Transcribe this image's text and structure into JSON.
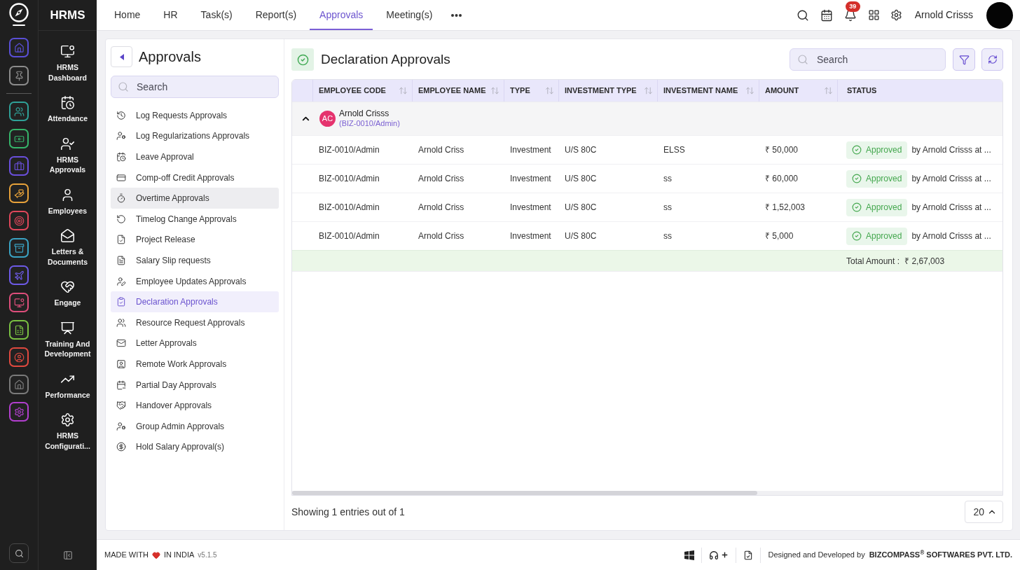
{
  "rail": {
    "pinned": [
      {
        "color": "#5a4fd6"
      },
      {
        "color": "#8c8c8c"
      }
    ],
    "apps": [
      {
        "color": "#2fa198"
      },
      {
        "color": "#35b56a"
      },
      {
        "color": "#6a4fdc"
      },
      {
        "color": "#e8a23a"
      },
      {
        "color": "#e0475b"
      },
      {
        "color": "#3aa3c4"
      },
      {
        "color": "#6d5ae6"
      },
      {
        "color": "#de4e7b"
      },
      {
        "color": "#7ac142"
      },
      {
        "color": "#e0493f"
      },
      {
        "color": "#7a7a7a"
      },
      {
        "color": "#b23fcf"
      }
    ]
  },
  "sidebar": {
    "brand": "HRMS",
    "items": [
      {
        "label": "HRMS Dashboard"
      },
      {
        "label": "Attendance"
      },
      {
        "label": "HRMS Approvals"
      },
      {
        "label": "Employees"
      },
      {
        "label": "Letters & Documents"
      },
      {
        "label": "Engage"
      },
      {
        "label": "Training And Development"
      },
      {
        "label": "Performance"
      },
      {
        "label": "HRMS Configurati..."
      }
    ]
  },
  "top_nav": {
    "tabs": [
      {
        "label": "Home",
        "selected": false
      },
      {
        "label": "HR",
        "selected": false
      },
      {
        "label": "Task(s)",
        "selected": false
      },
      {
        "label": "Report(s)",
        "selected": false
      },
      {
        "label": "Approvals",
        "selected": true
      },
      {
        "label": "Meeting(s)",
        "selected": false
      }
    ],
    "notifications": "39",
    "user_name": "Arnold Crisss"
  },
  "approvals_panel": {
    "title": "Approvals",
    "search": {
      "placeholder": "Search"
    },
    "items": [
      {
        "label": "Log Requests Approvals",
        "selected": false,
        "hovered": false
      },
      {
        "label": "Log Regularizations Approvals",
        "selected": false,
        "hovered": false
      },
      {
        "label": "Leave Approval",
        "selected": false,
        "hovered": false
      },
      {
        "label": "Comp-off Credit Approvals",
        "selected": false,
        "hovered": false
      },
      {
        "label": "Overtime Approvals",
        "selected": false,
        "hovered": true
      },
      {
        "label": "Timelog Change Approvals",
        "selected": false,
        "hovered": false
      },
      {
        "label": "Project Release",
        "selected": false,
        "hovered": false
      },
      {
        "label": "Salary Slip requests",
        "selected": false,
        "hovered": false
      },
      {
        "label": "Employee Updates Approvals",
        "selected": false,
        "hovered": false
      },
      {
        "label": "Declaration Approvals",
        "selected": true,
        "hovered": false
      },
      {
        "label": "Resource Request Approvals",
        "selected": false,
        "hovered": false
      },
      {
        "label": "Letter Approvals",
        "selected": false,
        "hovered": false
      },
      {
        "label": "Remote Work Approvals",
        "selected": false,
        "hovered": false
      },
      {
        "label": "Partial Day Approvals",
        "selected": false,
        "hovered": false
      },
      {
        "label": "Handover Approvals",
        "selected": false,
        "hovered": false
      },
      {
        "label": "Group Admin Approvals",
        "selected": false,
        "hovered": false
      },
      {
        "label": "Hold Salary Approval(s)",
        "selected": false,
        "hovered": false
      }
    ]
  },
  "declarations": {
    "title": "Declaration Approvals",
    "search": {
      "placeholder": "Search"
    },
    "table": {
      "columns": [
        {
          "label": "EMPLOYEE CODE",
          "sortable": true
        },
        {
          "label": "EMPLOYEE NAME",
          "sortable": true
        },
        {
          "label": "TYPE",
          "sortable": true
        },
        {
          "label": "INVESTMENT TYPE",
          "sortable": true
        },
        {
          "label": "INVESTMENT NAME",
          "sortable": true
        },
        {
          "label": "AMOUNT",
          "sortable": true
        },
        {
          "label": "STATUS",
          "sortable": false
        }
      ],
      "groups": [
        {
          "expanded": true,
          "initials": "AC",
          "name": "Arnold Crisss",
          "code": "(BIZ-0010/Admin)",
          "rows": [
            {
              "cells": [
                "BIZ-0010/Admin",
                "Arnold Criss",
                "Investment",
                "U/S 80C",
                "ELSS",
                "₹ 50,000"
              ],
              "status": {
                "label": "Approved",
                "kind": "approved",
                "note": "by Arnold Crisss at ..."
              }
            },
            {
              "cells": [
                "BIZ-0010/Admin",
                "Arnold Criss",
                "Investment",
                "U/S 80C",
                "ss",
                "₹ 60,000"
              ],
              "status": {
                "label": "Approved",
                "kind": "approved",
                "note": "by Arnold Crisss at ..."
              }
            },
            {
              "cells": [
                "BIZ-0010/Admin",
                "Arnold Criss",
                "Investment",
                "U/S 80C",
                "ss",
                "₹ 1,52,003"
              ],
              "status": {
                "label": "Approved",
                "kind": "approved",
                "note": "by Arnold Crisss at ..."
              }
            },
            {
              "cells": [
                "BIZ-0010/Admin",
                "Arnold Criss",
                "Investment",
                "U/S 80C",
                "ss",
                "₹ 5,000"
              ],
              "status": {
                "label": "Approved",
                "kind": "approved",
                "note": "by Arnold Crisss at ..."
              }
            }
          ]
        }
      ],
      "total": {
        "label": "Total Amount :",
        "value": "₹ 2,67,003"
      }
    },
    "summary": "Showing 1 entries out of 1",
    "page_size": "20"
  },
  "footer": {
    "made_with": "MADE WITH",
    "country": "IN INDIA",
    "version": "v5.1.5",
    "credit": "Designed and Developed by",
    "company": "BIZCOMPASS$^{®}$ SOFTWARES PVT. LTD."
  }
}
